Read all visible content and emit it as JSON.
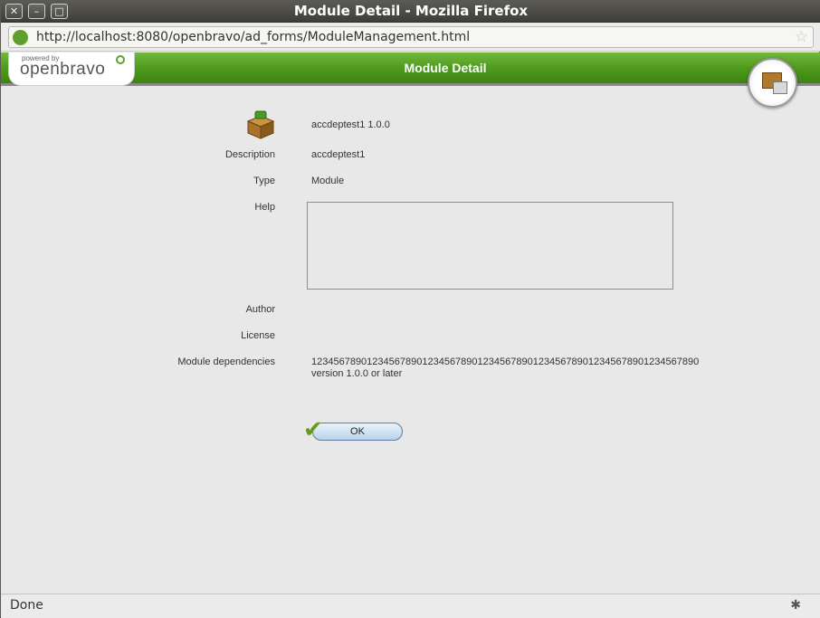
{
  "window": {
    "title": "Module Detail - Mozilla Firefox",
    "close_glyph": "✕",
    "min_glyph": "–",
    "max_glyph": "□"
  },
  "urlbar": {
    "url": "http://localhost:8080/openbravo/ad_forms/ModuleManagement.html",
    "star_glyph": "☆"
  },
  "header": {
    "logo_small": "powered by",
    "logo_main": "openbravo",
    "title": "Module Detail"
  },
  "module": {
    "name_version": "accdeptest1 1.0.0",
    "fields": {
      "description_label": "Description",
      "description_value": "accdeptest1",
      "type_label": "Type",
      "type_value": "Module",
      "help_label": "Help",
      "author_label": "Author",
      "author_value": "",
      "license_label": "License",
      "license_value": "",
      "dependencies_label": "Module dependencies",
      "dependency_name": "1234567890123456789012345678901234567890123456789012345678901234567890",
      "dependency_version": "version 1.0.0 or later"
    }
  },
  "buttons": {
    "ok_label": "OK"
  },
  "statusbar": {
    "text": "Done"
  },
  "icons": {
    "url_site": "openbravo-site-icon",
    "bookmark": "star-icon",
    "module": "module-package-icon",
    "header_badge": "module-management-icon",
    "ok_check": "check-icon",
    "status": "debug-bug-icon"
  },
  "colors": {
    "header_green": "#4f9a1e",
    "brand_green": "#5fa02c"
  }
}
